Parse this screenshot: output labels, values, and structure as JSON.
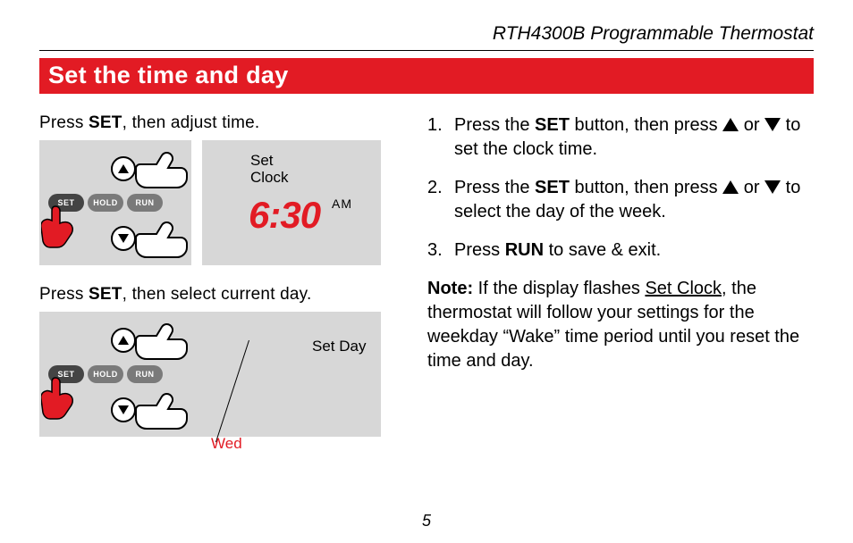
{
  "header": {
    "model": "RTH4300B Programmable Thermostat"
  },
  "title": "Set the time and day",
  "left": {
    "fig1": {
      "caption_pre": "Press ",
      "caption_bold": "SET",
      "caption_post": ", then adjust time.",
      "btn_set": "SET",
      "btn_hold": "HOLD",
      "btn_run": "RUN",
      "disp_label": "Set\nClock",
      "time": "6:30",
      "ampm": "AM"
    },
    "fig2": {
      "caption_pre": "Press ",
      "caption_bold": "SET",
      "caption_post": ", then select current day.",
      "btn_set": "SET",
      "btn_hold": "HOLD",
      "btn_run": "RUN",
      "disp_label": "Set Day",
      "day": "Wed"
    }
  },
  "right": {
    "steps": [
      {
        "pre": "Press the ",
        "b1": "SET",
        "mid": " button, then press ",
        "post": " to set the clock time."
      },
      {
        "pre": "Press the ",
        "b1": "SET",
        "mid": " button, then press ",
        "post": " to select the day of the week."
      },
      {
        "pre": "Press ",
        "b1": "RUN",
        "post": " to save & exit."
      }
    ],
    "note_label": "Note:",
    "note_pre": " If the display flashes ",
    "note_u": "Set Clock",
    "note_post": ", the thermostat will follow your settings for the weekday “Wake” time period until you reset the time and day."
  },
  "page": "5"
}
